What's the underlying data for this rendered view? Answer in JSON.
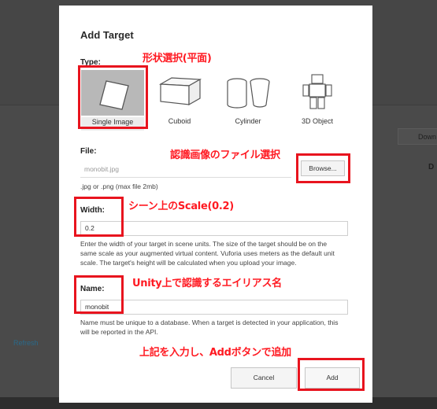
{
  "background": {
    "refresh_label": "Refresh",
    "download_label": "Down",
    "column_letter": "D"
  },
  "dialog": {
    "title": "Add Target",
    "type_label": "Type:",
    "types": [
      {
        "label": "Single Image",
        "icon": "single-image-icon",
        "selected": true
      },
      {
        "label": "Cuboid",
        "icon": "cuboid-icon",
        "selected": false
      },
      {
        "label": "Cylinder",
        "icon": "cylinder-icon",
        "selected": false
      },
      {
        "label": "3D Object",
        "icon": "3d-object-icon",
        "selected": false
      }
    ],
    "file_label": "File:",
    "file_value": "monobit.jpg",
    "browse_label": "Browse...",
    "file_hint": ".jpg or .png (max file 2mb)",
    "width_label": "Width:",
    "width_value": "0.2",
    "width_hint_1": "Enter the width of your target in scene units. The size of the target should be on the",
    "width_hint_2": "same scale as your augmented virtual content. Vuforia uses meters as the default unit",
    "width_hint_3": "scale. The target's height will be calculated when you upload your image.",
    "name_label": "Name:",
    "name_value": "monobit",
    "name_hint_1": "Name must be unique to a database. When a target is detected in your application, this",
    "name_hint_2": "will be reported in the API.",
    "cancel_label": "Cancel",
    "add_label": "Add"
  },
  "annotations": {
    "shape_select": "形状選択(平面)",
    "file_select": "認識画像のファイル選択",
    "scale": "シーン上のScale(0.2)",
    "alias": "Unity上で認識するエイリアス名",
    "add_note": "上記を入力し、Addボタンで追加"
  },
  "colors": {
    "annotation_red": "#e8141e",
    "modal_bg": "#ffffff",
    "overlay_bg": "#4a4a4a"
  }
}
